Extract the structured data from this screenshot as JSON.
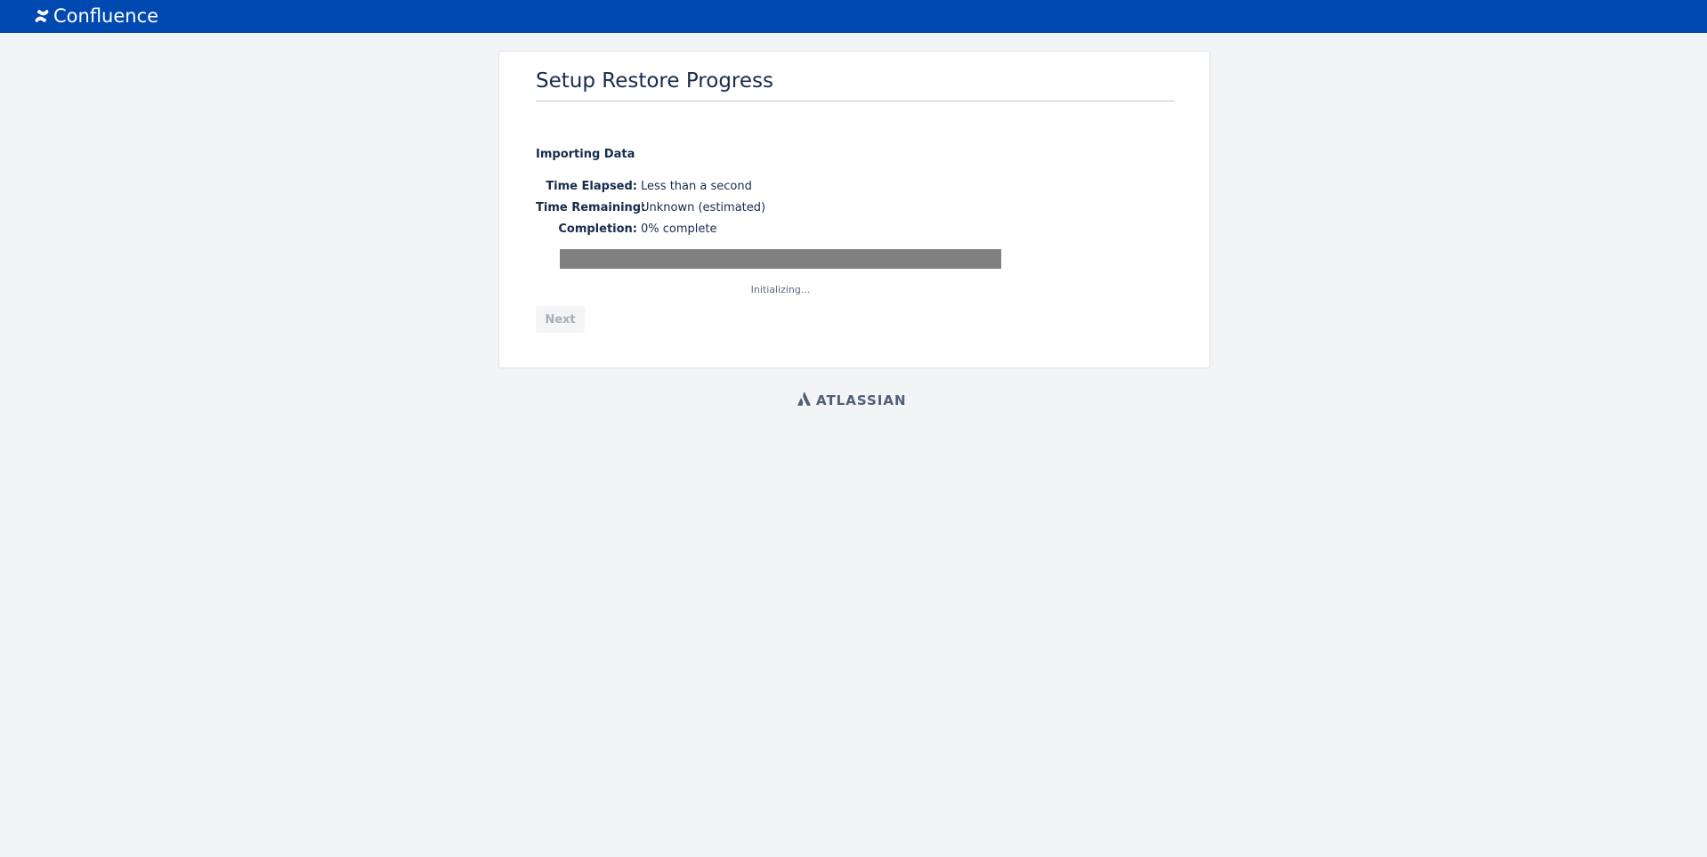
{
  "header": {
    "brand_name": "Confluence",
    "brand_icon": "confluence-icon",
    "background_color": "#0049b0"
  },
  "main": {
    "title": "Setup Restore Progress",
    "section_heading": "Importing Data",
    "stats": [
      {
        "label": "Time Elapsed:",
        "value": "Less than a second"
      },
      {
        "label": "Time Remaining:",
        "value": "Unknown (estimated)"
      },
      {
        "label": "Completion:",
        "value": "0% complete"
      }
    ],
    "progress": {
      "fraction": 0,
      "status": "Initializing...",
      "track_color": "#808080"
    },
    "next_button": {
      "label": "Next",
      "disabled": true
    }
  },
  "footer": {
    "brand_name": "ATLASSIAN",
    "brand_icon": "atlassian-icon"
  }
}
